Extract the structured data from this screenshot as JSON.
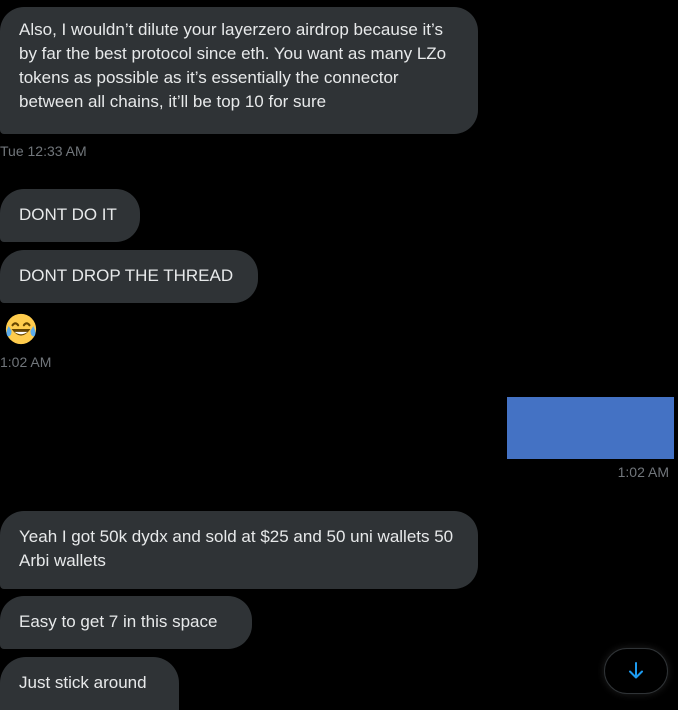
{
  "messages": {
    "m1": "Also, I wouldn’t dilute your layerzero airdrop because it’s by far the best protocol since eth. You want as many LZo tokens as possible as it’s essentially the connector between all chains, it’ll be top 10 for sure",
    "t1": "Tue 12:33 AM",
    "m2": "DONT DO IT",
    "m3": "DONT DROP THE THREAD",
    "t2": "1:02 AM",
    "t3": "1:02 AM",
    "m4": "Yeah I got 50k dydx and sold at $25 and 50 uni wallets 50 Arbi wallets",
    "m5": "Easy to get 7 in this space",
    "m6": "Just stick around"
  },
  "emoji": "face-with-tears-of-joy",
  "scroll_button_icon": "arrow-down-icon",
  "colors": {
    "background": "#000000",
    "bubble": "#2f3336",
    "text": "#e7e9ea",
    "timestamp": "#71767b",
    "accent": "#1d9bf0",
    "redacted_media": "#4472c4"
  }
}
